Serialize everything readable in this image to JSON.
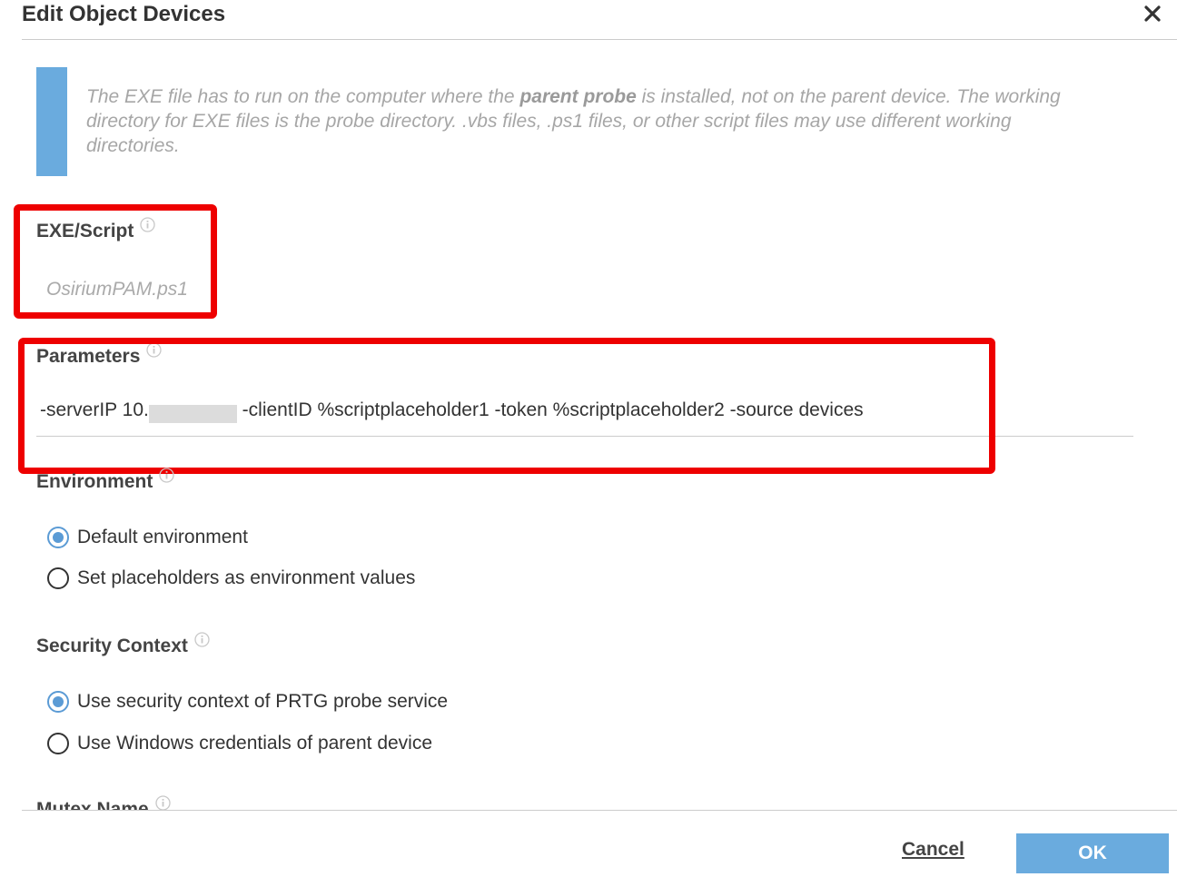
{
  "dialog": {
    "title": "Edit Object Devices"
  },
  "info": {
    "text_part1": "The EXE file has to run on the computer where the ",
    "text_bold": "parent probe",
    "text_part2": " is installed, not on the parent device. The working directory for EXE files is the probe directory. .vbs files, .ps1 files, or other script files may use different working directories."
  },
  "exe_script": {
    "label": "EXE/Script",
    "value": "OsiriumPAM.ps1"
  },
  "parameters": {
    "label": "Parameters",
    "value_prefix": "-serverIP 10.",
    "value_suffix": " -clientID %scriptplaceholder1 -token %scriptplaceholder2 -source devices"
  },
  "environment": {
    "label": "Environment",
    "options": [
      {
        "label": "Default environment",
        "checked": true
      },
      {
        "label": "Set placeholders as environment values",
        "checked": false
      }
    ]
  },
  "security_context": {
    "label": "Security Context",
    "options": [
      {
        "label": "Use security context of PRTG probe service",
        "checked": true
      },
      {
        "label": "Use Windows credentials of parent device",
        "checked": false
      }
    ]
  },
  "mutex": {
    "label": "Mutex Name"
  },
  "footer": {
    "cancel_label": "Cancel",
    "ok_label": "OK"
  },
  "colors": {
    "accent": "#6aabde",
    "highlight": "#ee0000",
    "radio_checked": "#5b9bd5"
  }
}
